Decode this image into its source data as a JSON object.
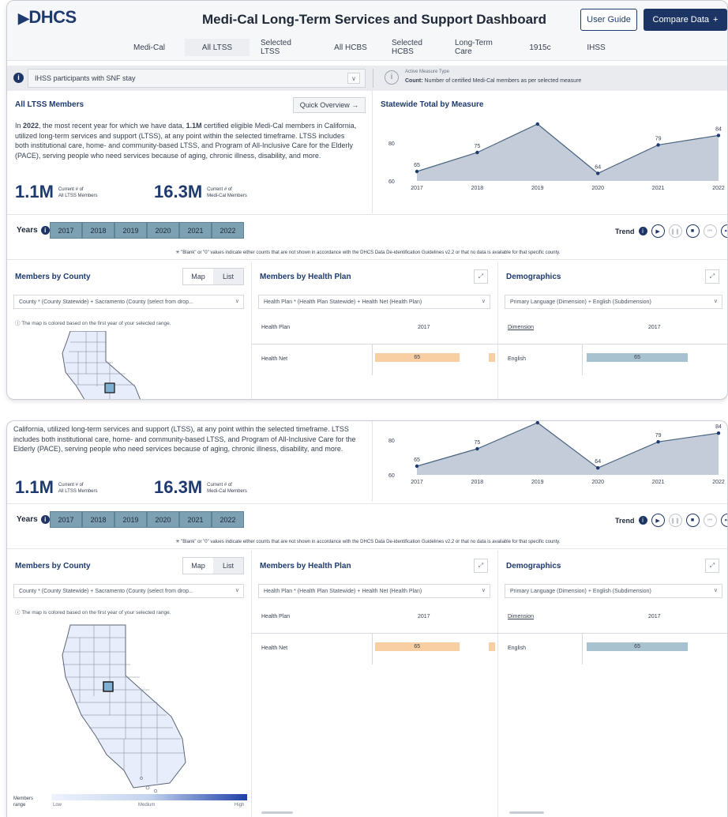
{
  "header": {
    "logo": "DHCS",
    "title": "Medi-Cal Long-Term Services and Support Dashboard",
    "user_guide": "User Guide",
    "compare": "Compare Data",
    "compare_icon": "+"
  },
  "tabs": [
    "Medi-Cal",
    "All LTSS",
    "Selected LTSS",
    "All HCBS",
    "Selected HCBS",
    "Long-Term Care",
    "1915c",
    "IHSS"
  ],
  "active_tab": "All LTSS",
  "measure": {
    "selected": "IHSS participants with SNF stay",
    "type_label": "Active Measure Type",
    "type_name": "Count:",
    "type_desc": "Number of certified Medi-Cal members as per selected measure"
  },
  "summary": {
    "title": "All LTSS Members",
    "quick_overview": "Quick Overview →",
    "text_year": "2022",
    "text_1": "In ",
    "text_2": ", the most recent year for which we have data, ",
    "text_count": "1.1M",
    "text_3": " certified eligible Medi-Cal members in California, utilized long-term services and support (LTSS), at any point within the selected timeframe. LTSS includes both institutional care, home- and community-based LTSS, and Program of All-Inclusive Care for the Elderly (PACE), serving people who need services because of aging, chronic illness, disability, and more.",
    "text_cont": "California, utilized long-term services and support (LTSS), at any point within the selected timeframe. LTSS includes both institutional care, home- and community-based LTSS, and Program of All-Inclusive Care for the Elderly (PACE), serving people who need services because of aging, chronic illness, disability, and more.",
    "kpi1_value": "1.1M",
    "kpi1_label1": "Current # of",
    "kpi1_label2": "All LTSS Members",
    "kpi2_value": "16.3M",
    "kpi2_label1": "Current # of",
    "kpi2_label2": "Medi-Cal Members"
  },
  "chart_data": {
    "type": "area",
    "title": "Statewide Total by Measure",
    "x": [
      "2017",
      "2018",
      "2019",
      "2020",
      "2021",
      "2022"
    ],
    "values": [
      65,
      75,
      90,
      64,
      79,
      84
    ],
    "data_labels": [
      "65",
      "75",
      "",
      "64",
      "79",
      "84"
    ],
    "y_ticks": [
      "80",
      "60"
    ],
    "ylim": [
      60,
      90
    ],
    "fill_color": "#c3ccd8",
    "line_color": "#4a6480",
    "point_color": "#1e3a6e"
  },
  "years": {
    "label": "Years",
    "list": [
      "2017",
      "2018",
      "2019",
      "2020",
      "2021",
      "2022"
    ],
    "trend_label": "Trend"
  },
  "disclaimer": "✳ \"Blank\" or \"0\" values indicate either counts that are not shown in accordance with the DHCS Data De-identification Guidelines v2.2 or that no data is available for that specific county.",
  "county": {
    "title": "Members by County",
    "map_label": "Map",
    "list_label": "List",
    "select": "County * (County Statewide) + Sacramento (County (select from drop...",
    "note": "ⓘ The map is colored based on the first year of your selected range.",
    "legend_title_1": "Members",
    "legend_title_2": "range",
    "legend_low": "Low",
    "legend_mid": "Medium",
    "legend_high": "High"
  },
  "health_plan": {
    "title": "Members by Health Plan",
    "select": "Health Plan * (Health Plan Statewide) + Health Net (Health Plan)",
    "col_label": "Health Plan",
    "year": "2017",
    "row_label": "Health Net",
    "row_value": "65",
    "bar_fraction": 0.62,
    "bar_color": "#f8cfa3"
  },
  "demographics": {
    "title": "Demographics",
    "select": "Primary Language (Dimension) + English (Subdimension)",
    "col_label": "Dimension",
    "year": "2017",
    "row_label": "English",
    "row_value": "65",
    "bar_fraction": 0.72,
    "bar_color": "#a9c2cf"
  }
}
